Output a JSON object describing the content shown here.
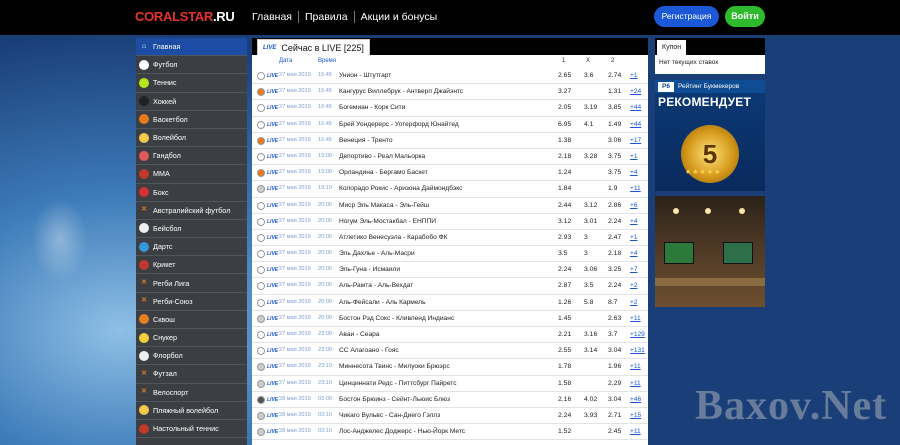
{
  "header": {
    "logo_main": "CORALSTAR",
    "logo_domain": ".RU",
    "nav": [
      "Главная",
      "Правила",
      "Акции и бонусы"
    ],
    "register_label": "Регистрация",
    "login_label": "Войти"
  },
  "sidebar": {
    "items": [
      {
        "label": "Главная",
        "icon": "home-icon",
        "color": "#ffffff"
      },
      {
        "label": "Футбол",
        "icon": "soccer-ball-icon",
        "color": "#ffffff"
      },
      {
        "label": "Теннис",
        "icon": "tennis-ball-icon",
        "color": "#b5e61d"
      },
      {
        "label": "Хоккей",
        "icon": "hockey-icon",
        "color": "#222222"
      },
      {
        "label": "Баскетбол",
        "icon": "basketball-icon",
        "color": "#e67a1c"
      },
      {
        "label": "Волейбол",
        "icon": "volleyball-icon",
        "color": "#f2c94c"
      },
      {
        "label": "Гандбол",
        "icon": "handball-icon",
        "color": "#e05a5a"
      },
      {
        "label": "MMA",
        "icon": "mma-glove-icon",
        "color": "#c0392b"
      },
      {
        "label": "Бокс",
        "icon": "boxing-glove-icon",
        "color": "#d32f2f"
      },
      {
        "label": "Австралийский футбол",
        "icon": "crossed-sticks-icon",
        "color": "#e67e22"
      },
      {
        "label": "Бейсбол",
        "icon": "baseball-icon",
        "color": "#eeeeee"
      },
      {
        "label": "Дартс",
        "icon": "darts-icon",
        "color": "#3498db"
      },
      {
        "label": "Крикет",
        "icon": "cricket-icon",
        "color": "#c0392b"
      },
      {
        "label": "Регби Лига",
        "icon": "crossed-sticks-icon",
        "color": "#e67e22"
      },
      {
        "label": "Регби-Союз",
        "icon": "crossed-sticks-icon",
        "color": "#e67e22"
      },
      {
        "label": "Сквош",
        "icon": "squash-icon",
        "color": "#e67e22"
      },
      {
        "label": "Снукер",
        "icon": "snooker-icon",
        "color": "#f4d03f"
      },
      {
        "label": "Флорбол",
        "icon": "floorball-icon",
        "color": "#eeeeee"
      },
      {
        "label": "Футзал",
        "icon": "crossed-sticks-icon",
        "color": "#e67e22"
      },
      {
        "label": "Велоспорт",
        "icon": "crossed-sticks-icon",
        "color": "#e67e22"
      },
      {
        "label": "Пляжный волейбол",
        "icon": "beach-volleyball-icon",
        "color": "#f2c94c"
      },
      {
        "label": "Настольный теннис",
        "icon": "table-tennis-icon",
        "color": "#c0392b"
      }
    ]
  },
  "main": {
    "live_badge": "LIVE",
    "title": "Сейчас в LIVE [225]",
    "columns": {
      "date": "Дата",
      "time": "Время",
      "c1": "1",
      "cx": "X",
      "c2": "2"
    },
    "rows": [
      {
        "icon": "soccer-ball-icon",
        "icolor": "#ffffff",
        "date": "27 мая 2019",
        "time": "15:45",
        "match": "Унион - Штутгарт",
        "o1": "2.65",
        "ox": "3.6",
        "o2": "2.74",
        "more": "+1"
      },
      {
        "icon": "basketball-icon",
        "icolor": "#e67a1c",
        "date": "27 мая 2019",
        "time": "15:45",
        "match": "Кангурус Виллебрук - Антверп Джайэнтс",
        "o1": "3.27",
        "ox": "",
        "o2": "1.31",
        "more": "+24"
      },
      {
        "icon": "soccer-ball-icon",
        "icolor": "#ffffff",
        "date": "27 мая 2019",
        "time": "16:45",
        "match": "Богемиан - Корк Сити",
        "o1": "2.05",
        "ox": "3.19",
        "o2": "3.85",
        "more": "+44"
      },
      {
        "icon": "soccer-ball-icon",
        "icolor": "#ffffff",
        "date": "27 мая 2019",
        "time": "16:45",
        "match": "Брей Уондерерс - Уотерфорд Юнайтед",
        "o1": "6.95",
        "ox": "4.1",
        "o2": "1.49",
        "more": "+44"
      },
      {
        "icon": "basketball-icon",
        "icolor": "#e67a1c",
        "date": "27 мая 2019",
        "time": "16:45",
        "match": "Венеция - Тренто",
        "o1": "1.38",
        "ox": "",
        "o2": "3.06",
        "more": "+17"
      },
      {
        "icon": "soccer-ball-icon",
        "icolor": "#ffffff",
        "date": "27 мая 2019",
        "time": "19:00",
        "match": "Депортиво - Реал Мальорка",
        "o1": "2.18",
        "ox": "3.28",
        "o2": "3.75",
        "more": "+1"
      },
      {
        "icon": "basketball-icon",
        "icolor": "#e67a1c",
        "date": "27 мая 2019",
        "time": "19:00",
        "match": "Орландина - Бергамо Баскет",
        "o1": "1.24",
        "ox": "",
        "o2": "3.75",
        "more": "+4"
      },
      {
        "icon": "baseball-icon",
        "icolor": "#cccccc",
        "date": "27 мая 2019",
        "time": "19:10",
        "match": "Колорадо Рокис - Аризона Даймондбэкс",
        "o1": "1.84",
        "ox": "",
        "o2": "1.9",
        "more": "+11"
      },
      {
        "icon": "soccer-ball-icon",
        "icolor": "#ffffff",
        "date": "27 мая 2019",
        "time": "20:00",
        "match": "Миср Эль Макаса - Эль-Гейш",
        "o1": "2.44",
        "ox": "3.12",
        "o2": "2.86",
        "more": "+6"
      },
      {
        "icon": "soccer-ball-icon",
        "icolor": "#ffffff",
        "date": "27 мая 2019",
        "time": "20:00",
        "match": "Ногум Эль-Мостакбал - ЕНППИ",
        "o1": "3.12",
        "ox": "3.01",
        "o2": "2.24",
        "more": "+4"
      },
      {
        "icon": "soccer-ball-icon",
        "icolor": "#ffffff",
        "date": "27 мая 2019",
        "time": "20:00",
        "match": "Атлетико Венесуэла - Карабобо ФК",
        "o1": "2.93",
        "ox": "3",
        "o2": "2.47",
        "more": "+1"
      },
      {
        "icon": "soccer-ball-icon",
        "icolor": "#ffffff",
        "date": "27 мая 2019",
        "time": "20:00",
        "match": "Эль Дахлье - Аль-Масри",
        "o1": "3.5",
        "ox": "3",
        "o2": "2.18",
        "more": "+4"
      },
      {
        "icon": "soccer-ball-icon",
        "icolor": "#ffffff",
        "date": "27 мая 2019",
        "time": "20:00",
        "match": "Эль-Гуна - Исмаили",
        "o1": "2.24",
        "ox": "3.06",
        "o2": "3.25",
        "more": "+7"
      },
      {
        "icon": "soccer-ball-icon",
        "icolor": "#ffffff",
        "date": "27 мая 2019",
        "time": "20:00",
        "match": "Аль-Рамта - Аль-Вехдат",
        "o1": "2.87",
        "ox": "3.5",
        "o2": "2.24",
        "more": "+2"
      },
      {
        "icon": "soccer-ball-icon",
        "icolor": "#ffffff",
        "date": "27 мая 2019",
        "time": "20:00",
        "match": "Аль-Фейсали - Аль Кармель",
        "o1": "1.26",
        "ox": "5.8",
        "o2": "8.7",
        "more": "+2"
      },
      {
        "icon": "baseball-icon",
        "icolor": "#cccccc",
        "date": "27 мая 2019",
        "time": "20:00",
        "match": "Бостон Рэд Сокс - Кливленд Индианс",
        "o1": "1.45",
        "ox": "",
        "o2": "2.63",
        "more": "+11"
      },
      {
        "icon": "soccer-ball-icon",
        "icolor": "#ffffff",
        "date": "27 мая 2019",
        "time": "23:00",
        "match": "Аваи - Сеара",
        "o1": "2.21",
        "ox": "3.16",
        "o2": "3.7",
        "more": "+129"
      },
      {
        "icon": "soccer-ball-icon",
        "icolor": "#ffffff",
        "date": "27 мая 2019",
        "time": "23:00",
        "match": "СС Алагоано - Гояс",
        "o1": "2.55",
        "ox": "3.14",
        "o2": "3.04",
        "more": "+131"
      },
      {
        "icon": "baseball-icon",
        "icolor": "#cccccc",
        "date": "27 мая 2019",
        "time": "23:10",
        "match": "Миннесота Твинс - Милуоки Брюэрс",
        "o1": "1.78",
        "ox": "",
        "o2": "1.96",
        "more": "+11"
      },
      {
        "icon": "baseball-icon",
        "icolor": "#cccccc",
        "date": "27 мая 2019",
        "time": "23:10",
        "match": "Цинциннати Редс - Питтсбург Пайретс",
        "o1": "1.58",
        "ox": "",
        "o2": "2.29",
        "more": "+11"
      },
      {
        "icon": "hockey-stick-icon",
        "icolor": "#555555",
        "date": "28 мая 2019",
        "time": "03:00",
        "match": "Бостон Брюинз - Сейнт-Льюис Блюз",
        "o1": "2.16",
        "ox": "4.02",
        "o2": "3.04",
        "more": "+46"
      },
      {
        "icon": "baseball-icon",
        "icolor": "#cccccc",
        "date": "28 мая 2019",
        "time": "03:10",
        "match": "Чикаго Вульвс - Сан-Диего Гэллз",
        "o1": "2.24",
        "ox": "3.93",
        "o2": "2.71",
        "more": "+15"
      },
      {
        "icon": "baseball-icon",
        "icolor": "#cccccc",
        "date": "28 мая 2019",
        "time": "03:10",
        "match": "Лос-Анджелес Доджерс - Нью-Йорк Метс",
        "o1": "1.52",
        "ox": "",
        "o2": "2.45",
        "more": "+11"
      }
    ]
  },
  "coupon": {
    "tab": "Купон",
    "empty": "Нет текущих ставок"
  },
  "banner1": {
    "logo": "Р6",
    "heading": "Рейтинг Букмекеров",
    "text": "РЕКОМЕНДУЕТ",
    "number": "5",
    "stars": "★★★★★"
  },
  "watermark": "Baxov.Net"
}
